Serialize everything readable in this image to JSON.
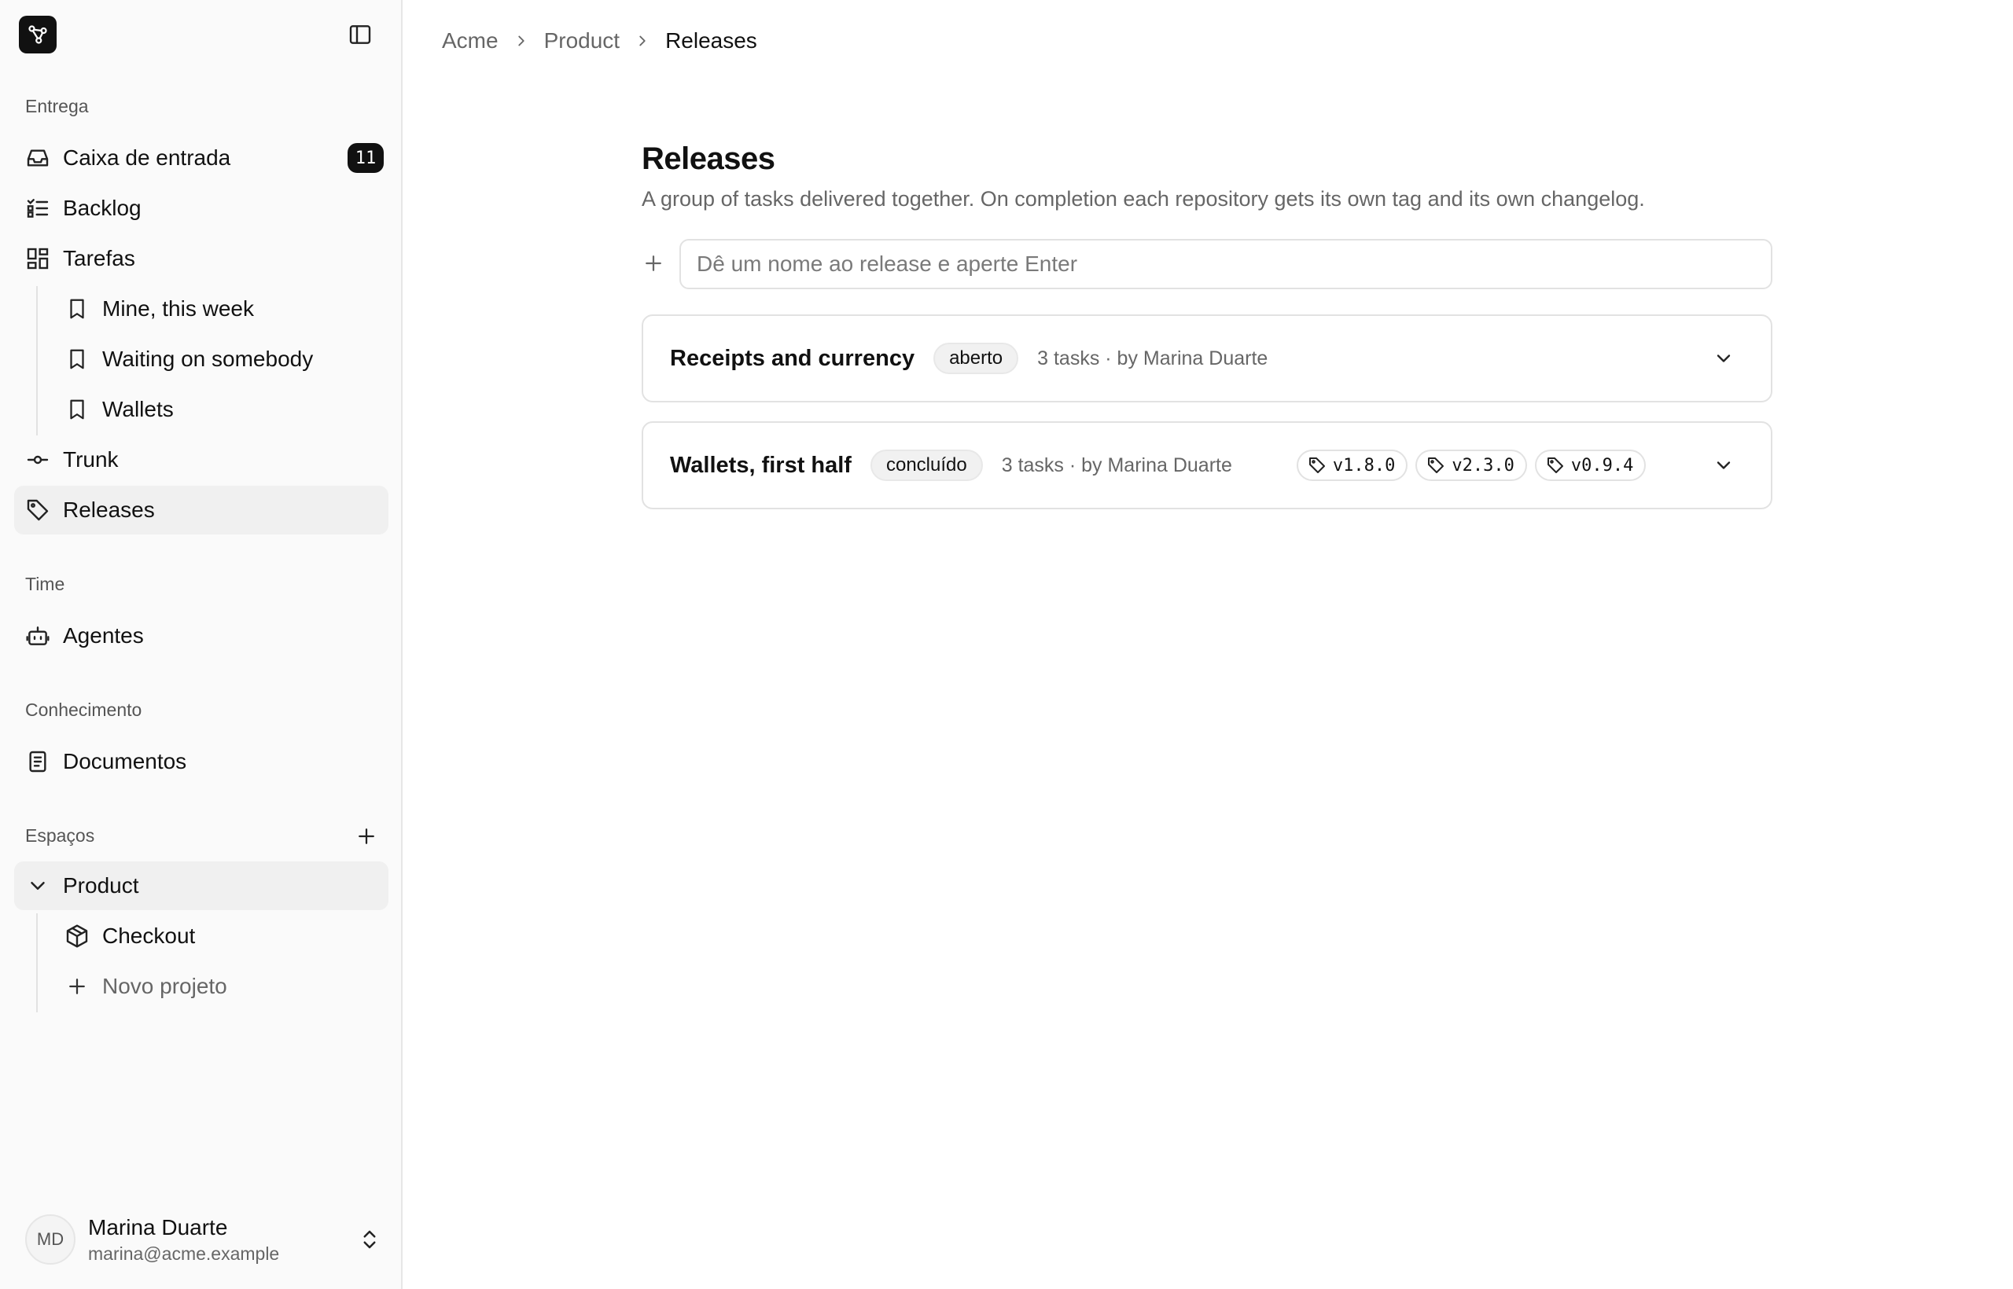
{
  "sidebar": {
    "sections": {
      "delivery": "Entrega",
      "team": "Time",
      "knowledge": "Conhecimento",
      "spaces": "Espaços"
    },
    "items": {
      "inbox": {
        "label": "Caixa de entrada",
        "badge": "11",
        "icon": "inbox-icon"
      },
      "backlog": {
        "label": "Backlog",
        "icon": "list-checks-icon"
      },
      "tasks": {
        "label": "Tarefas",
        "icon": "dashboard-icon"
      },
      "view_mine": {
        "label": "Mine, this week",
        "icon": "bookmark-icon"
      },
      "view_waiting": {
        "label": "Waiting on somebody",
        "icon": "bookmark-icon"
      },
      "view_wallets": {
        "label": "Wallets",
        "icon": "bookmark-icon"
      },
      "trunk": {
        "label": "Trunk",
        "icon": "git-commit-icon"
      },
      "releases": {
        "label": "Releases",
        "icon": "tag-icon",
        "active": true
      },
      "agents": {
        "label": "Agentes",
        "icon": "bot-icon"
      },
      "documents": {
        "label": "Documentos",
        "icon": "document-icon"
      }
    },
    "spaces": {
      "product": {
        "label": "Product",
        "expanded": true
      },
      "checkout": {
        "label": "Checkout",
        "icon": "package-icon"
      },
      "new_project": {
        "label": "Novo projeto",
        "icon": "plus-icon"
      }
    },
    "user": {
      "initials": "MD",
      "name": "Marina Duarte",
      "email": "marina@acme.example"
    }
  },
  "breadcrumb": [
    "Acme",
    "Product",
    "Releases"
  ],
  "page": {
    "title": "Releases",
    "description": "A group of tasks delivered together. On completion each repository gets its own tag and its own changelog.",
    "new_release_placeholder": "Dê um nome ao release e aperte Enter"
  },
  "releases": [
    {
      "name": "Receipts and currency",
      "status": "aberto",
      "meta": "3 tasks · by Marina Duarte",
      "tags": []
    },
    {
      "name": "Wallets, first half",
      "status": "concluído",
      "meta": "3 tasks · by Marina Duarte",
      "tags": [
        "v1.8.0",
        "v2.3.0",
        "v0.9.4"
      ]
    }
  ],
  "colors": {
    "accent": "#111111",
    "sidebar_bg": "#fafafa",
    "border": "#e2e2e2",
    "muted_text": "#666666"
  }
}
